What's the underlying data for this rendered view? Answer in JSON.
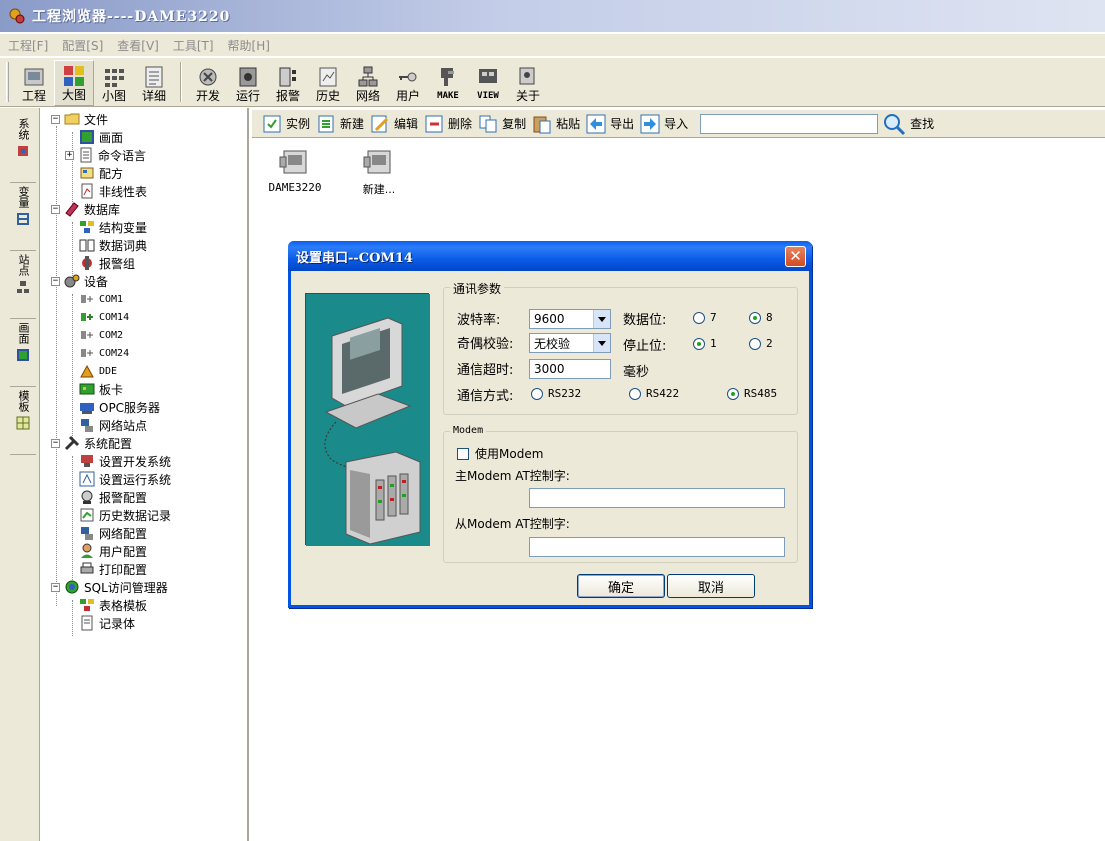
{
  "window": {
    "title": "工程浏览器----DAME3220"
  },
  "menubar": [
    {
      "label": "工程[F]"
    },
    {
      "label": "配置[S]"
    },
    {
      "label": "查看[V]"
    },
    {
      "label": "工具[T]"
    },
    {
      "label": "帮助[H]"
    }
  ],
  "toolbar": {
    "view_buttons": [
      {
        "label": "工程",
        "icon": "project-icon"
      },
      {
        "label": "大图",
        "icon": "large-icons-icon",
        "pressed": true
      },
      {
        "label": "小图",
        "icon": "small-icons-icon"
      },
      {
        "label": "详细",
        "icon": "details-icon"
      }
    ],
    "action_buttons": [
      {
        "label": "开发",
        "icon": "develop-icon"
      },
      {
        "label": "运行",
        "icon": "run-icon"
      },
      {
        "label": "报警",
        "icon": "alarm-icon"
      },
      {
        "label": "历史",
        "icon": "history-icon"
      },
      {
        "label": "网络",
        "icon": "network-icon"
      },
      {
        "label": "用户",
        "icon": "user-key-icon"
      },
      {
        "label": "MAKE",
        "icon": "make-icon"
      },
      {
        "label": "VIEW",
        "icon": "view-icon"
      },
      {
        "label": "关于",
        "icon": "about-icon"
      }
    ]
  },
  "side_tabs": [
    {
      "label": "系统"
    },
    {
      "label": "变量"
    },
    {
      "label": "站点"
    },
    {
      "label": "画面"
    },
    {
      "label": "模板"
    }
  ],
  "tree": {
    "file": {
      "label": "文件",
      "children": [
        "画面",
        "命令语言",
        "配方",
        "非线性表"
      ]
    },
    "database": {
      "label": "数据库",
      "children": [
        "结构变量",
        "数据词典",
        "报警组"
      ]
    },
    "devices": {
      "label": "设备",
      "children": [
        "COM1",
        "COM14",
        "COM2",
        "COM24",
        "DDE",
        "板卡",
        "OPC服务器",
        "网络站点"
      ]
    },
    "sysconfig": {
      "label": "系统配置",
      "children": [
        "设置开发系统",
        "设置运行系统",
        "报警配置",
        "历史数据记录",
        "网络配置",
        "用户配置",
        "打印配置"
      ]
    },
    "sql": {
      "label": "SQL访问管理器",
      "children": [
        "表格模板",
        "记录体"
      ]
    }
  },
  "content_toolbar": {
    "buttons": [
      "实例",
      "新建",
      "编辑",
      "删除",
      "复制",
      "粘贴",
      "导出",
      "导入"
    ],
    "search_value": "",
    "search_label": "查找"
  },
  "content_items": [
    {
      "label": "DAME3220"
    },
    {
      "label": "新建..."
    }
  ],
  "dialog": {
    "title": "设置串口--COM14",
    "comm_group": "通讯参数",
    "baud_label": "波特率:",
    "baud_value": "9600",
    "parity_label": "奇偶校验:",
    "parity_value": "无校验",
    "timeout_label": "通信超时:",
    "timeout_value": "3000",
    "timeout_unit": "毫秒",
    "databits_label": "数据位:",
    "databits_options": [
      "7",
      "8"
    ],
    "databits_selected": "8",
    "stopbits_label": "停止位:",
    "stopbits_options": [
      "1",
      "2"
    ],
    "stopbits_selected": "1",
    "mode_label": "通信方式:",
    "mode_options": [
      "RS232",
      "RS422",
      "RS485"
    ],
    "mode_selected": "RS485",
    "modem_group": "Modem",
    "use_modem_label": "使用Modem",
    "master_at_label": "主Modem AT控制字:",
    "master_at_value": "",
    "slave_at_label": "从Modem AT控制字:",
    "slave_at_value": "",
    "ok_label": "确定",
    "cancel_label": "取消"
  },
  "colors": {
    "dialog_border": "#0054e3",
    "title_gradient_start": "#8a9bc8",
    "teal_panel": "#1a8a8a"
  }
}
